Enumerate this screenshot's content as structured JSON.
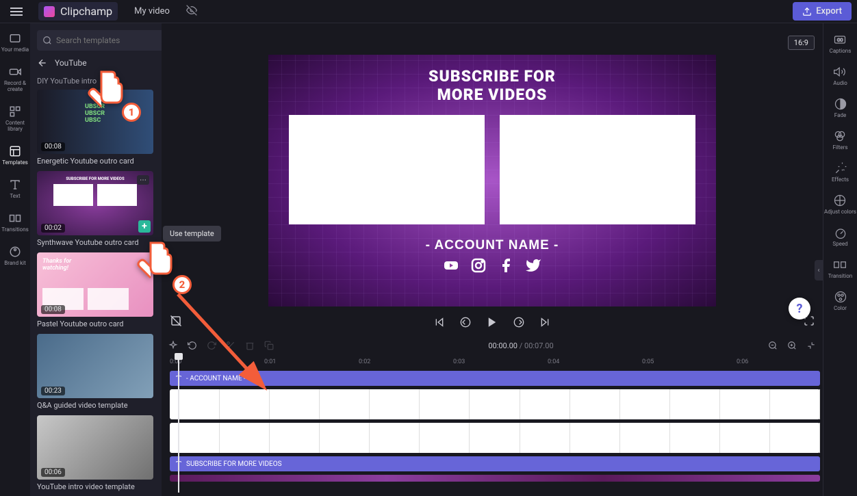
{
  "topbar": {
    "app_name": "Clipchamp",
    "video_title": "My video",
    "export_label": "Export"
  },
  "left_rail": {
    "items": [
      {
        "label": "Your media"
      },
      {
        "label": "Record & create"
      },
      {
        "label": "Content library"
      },
      {
        "label": "Templates"
      },
      {
        "label": "Text"
      },
      {
        "label": "Transitions"
      },
      {
        "label": "Brand kit"
      }
    ]
  },
  "side_panel": {
    "search_placeholder": "Search templates",
    "back_label": "YouTube",
    "subcategory": "DIY YouTube intro",
    "templates": [
      {
        "duration": "00:08",
        "title": ""
      },
      {
        "duration": "00:02",
        "title": "Energetic Youtube outro card"
      },
      {
        "duration": "00:08",
        "title": "Synthwave Youtube outro card"
      },
      {
        "duration": "00:23",
        "title": "Pastel Youtube outro card"
      },
      {
        "duration": "00:06",
        "title": "Q&A guided video template"
      },
      {
        "duration": "",
        "title": "YouTube intro video template"
      }
    ],
    "tooltip": "Use template"
  },
  "preview": {
    "aspect": "16:9",
    "title_line1": "SUBSCRIBE FOR",
    "title_line2": "MORE VIDEOS",
    "account": "- ACCOUNT NAME -"
  },
  "playback": {
    "timecode_current": "00:00.00",
    "timecode_total": "00:07.00"
  },
  "right_rail": {
    "items": [
      {
        "label": "Captions"
      },
      {
        "label": "Audio"
      },
      {
        "label": "Fade"
      },
      {
        "label": "Filters"
      },
      {
        "label": "Effects"
      },
      {
        "label": "Adjust colors"
      },
      {
        "label": "Speed"
      },
      {
        "label": "Transition"
      },
      {
        "label": "Color"
      }
    ]
  },
  "timeline": {
    "ruler": [
      "0:00",
      "0:01",
      "0:02",
      "0:03",
      "0:04",
      "0:05",
      "0:06"
    ],
    "tracks": {
      "text1": "- ACCOUNT NAME -",
      "text2": "SUBSCRIBE FOR MORE VIDEOS"
    }
  },
  "annotations": {
    "step1": "1",
    "step2": "2"
  },
  "help": "?",
  "thumb2_text": "SUBSCRIBE FOR MORE VIDEOS"
}
